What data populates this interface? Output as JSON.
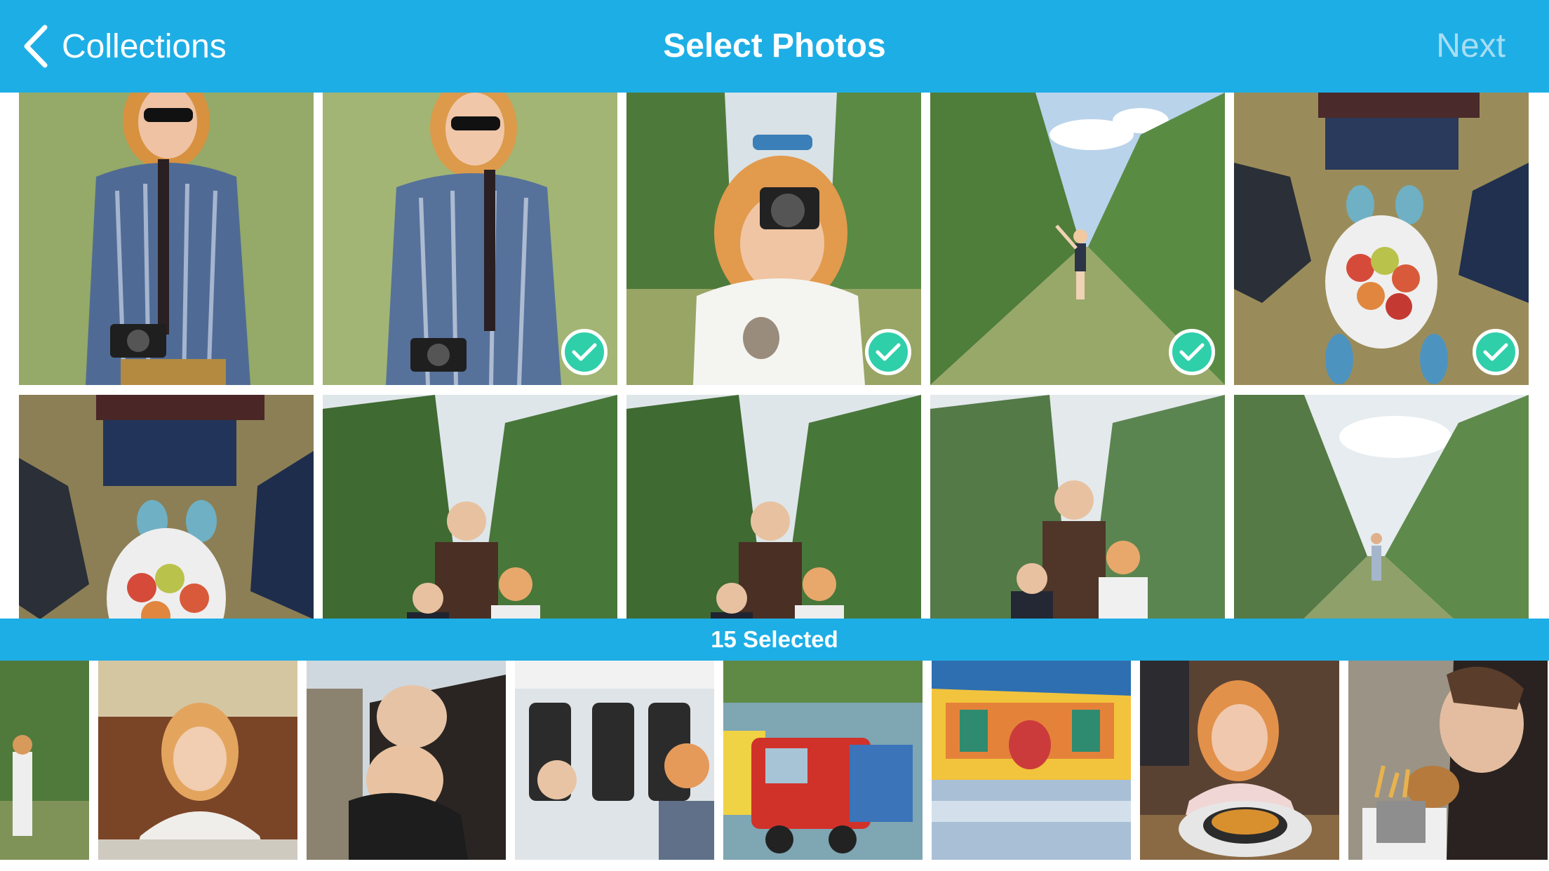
{
  "nav": {
    "back_label": "Collections",
    "title": "Select Photos",
    "next_label": "Next",
    "back_icon": "chevron-left-icon"
  },
  "colors": {
    "nav_background": "#1eaee6",
    "next_disabled": "#a8ddf3",
    "check_badge": "#2fcfaa"
  },
  "grid": {
    "photos": [
      {
        "subject": "girl in plaid shirt with sunglasses and camera",
        "selected": false
      },
      {
        "subject": "girl in plaid shirt with sunglasses and camera",
        "selected": true
      },
      {
        "subject": "girl holding camera to face in orchard",
        "selected": true
      },
      {
        "subject": "boy pointing in apple orchard row",
        "selected": true
      },
      {
        "subject": "feet and bag of apples from above",
        "selected": true
      },
      {
        "subject": "feet and bag of apples from above",
        "selected": false
      },
      {
        "subject": "mother and two children in orchard",
        "selected": false
      },
      {
        "subject": "mother and two children in orchard",
        "selected": false
      },
      {
        "subject": "mother and two children in orchard",
        "selected": false
      },
      {
        "subject": "child standing far down orchard row",
        "selected": false
      }
    ]
  },
  "selection": {
    "label": "15 Selected"
  },
  "tray": {
    "thumbnails": [
      "child in orchard row",
      "girl at restaurant table",
      "boy hugging adult",
      "kids on a ride vehicle",
      "red truck carnival ride",
      "spinning carnival ride",
      "girl with skillet dish",
      "person eating burger"
    ]
  }
}
